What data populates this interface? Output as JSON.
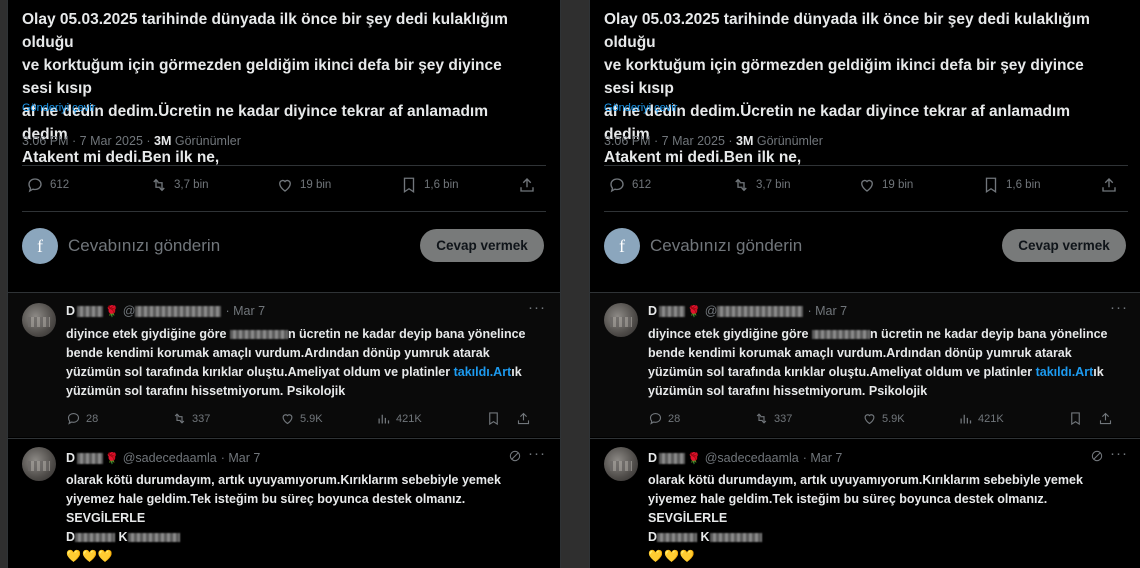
{
  "tweet": {
    "line1": "Olay 05.03.2025 tarihinde dünyada ilk önce bir şey dedi kulaklığım olduğu",
    "line2": "ve korktuğum için görmezden geldiğim ikinci defa bir şey diyince sesi kısıp",
    "line3": "af ne dedin dedim.Ücretin ne kadar diyince tekrar af anlamadım dedim",
    "line4": "Atakent mi dedi.Ben ilk ne,",
    "translate_label": "Gönderiyi çevir",
    "time": "3:06 PM · 7 Mar 2025 · ",
    "views_count": "3M",
    "views_label": " Görünümler"
  },
  "stats": {
    "replies": "612",
    "reposts": "3,7 bin",
    "likes": "19 bin",
    "bookmarks": "1,6 bin"
  },
  "reply_box": {
    "avatar_letter": "f",
    "placeholder": "Cevabınızı gönderin",
    "button_label": "Cevap vermek"
  },
  "comment1": {
    "name_initial": "D",
    "date": "· Mar 7",
    "line1": "diyince etek giydiğine göre ",
    "line1b": "n ücretin ne kadar deyip bana yönelince",
    "line2": "bende kendimi korumak amaçlı vurdum.Ardından dönüp yumruk atarak",
    "line3": "yüzümün sol tarafında kırıklar oluştu.Ameliyat oldum ve platinler ",
    "line3_link": "takıldı.Art",
    "line3_end": "ık",
    "line4": "yüzümün sol tarafını hissetmiyorum. Psikolojik",
    "replies": "28",
    "reposts": "337",
    "likes": "5.9K",
    "views": "421K"
  },
  "comment2": {
    "name_initial": "D",
    "handle": "@sadecedaamla",
    "date": "· Mar 7",
    "line1": "olarak kötü durumdayım, artık uyuyamıyorum.Kırıklarım sebebiyle yemek",
    "line2": "yiyemez hale geldim.Tek isteğim bu süreç boyunca destek olmanız.",
    "line3": "SEVGİLERLE",
    "line4a": "D",
    "line4b": " K",
    "hearts": "💛💛💛"
  },
  "more_label": "···",
  "colors": {
    "link": "#1d9bf0",
    "background": "#000000",
    "muted": "#71767b"
  }
}
